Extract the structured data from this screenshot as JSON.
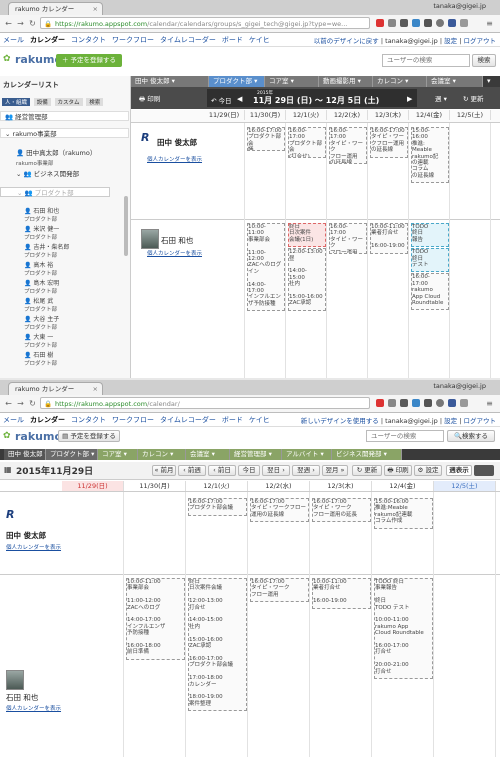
{
  "browser": {
    "tab_title": "rakumo カレンダー",
    "user": "tanaka@gigei.jp",
    "url_old_host": "https://rakumo.appspot.com",
    "url_old_path": "/calendar/calendars/groups/s_gigei_tech@gigei.jp?type=we...",
    "url_new_host": "https://rakumo.appspot.com",
    "url_new_path": "/calendar/"
  },
  "app_nav": {
    "items": [
      "メール",
      "カレンダー",
      "コンタクト",
      "ワークフロー",
      "タイムレコーダー",
      "ボード",
      "ケイヒ"
    ],
    "old_design_link": "以前のデザインに戻す",
    "new_design_link": "新しいデザインを使用する",
    "user": "tanaka@gigei.jp",
    "settings": "設定",
    "logout": "ログアウト",
    "sep": "|"
  },
  "top": {
    "logo": "rakumo",
    "add_button": "予定を登録する",
    "search_placeholder": "ユーザーの検索",
    "search_button": "検索",
    "sidebar_title": "カレンダーリスト",
    "sidebar_tabs": [
      "人・組織",
      "設備",
      "カスタム",
      "検索"
    ],
    "sidebar_tree": [
      "経営管理部",
      "rakumo事業部",
      "田中真太郎（rakumo）",
      "rakumo事業部",
      "ビジネス開発部",
      "プロダクト部"
    ],
    "sidebar_people": [
      "石田 和也",
      "米沢 健一",
      "吉井・柴名郎",
      "高木 裕",
      "島木 宏明",
      "松尾 武",
      "大谷 主子",
      "大東 一",
      "石田 樹"
    ],
    "sidebar_role": "プロダクト部",
    "groups": [
      "田中 俊太郎",
      "プロダクト部",
      "コア室",
      "動画撮影用",
      "カレコン",
      "会議室"
    ],
    "print": "印刷",
    "today": "今日",
    "year": "2015年",
    "range": "11月 29日 (日) 〜 12月 5日 (土)",
    "week": "週",
    "refresh": "更新",
    "days": [
      "11/29(日)",
      "11/30(月)",
      "12/1(火)",
      "12/2(水)",
      "12/3(木)",
      "12/4(金)",
      "12/5(土)"
    ],
    "person1": "田中 俊太郎",
    "person1_link": "個人カレンダーを表示",
    "person2": "石田 和也",
    "person2_link": "個人カレンダーを表示",
    "p1_events": [
      {
        "d": 1,
        "t": "16:00-17:00\nプロダクト部会\n議"
      },
      {
        "d": 2,
        "t": "16:00-\n17:00\nプロダクト部会\n(打合せ)"
      },
      {
        "d": 3,
        "t": "16:00-\n17:00\nタイピ・ワーク\nフロー運用\nの延長線"
      },
      {
        "d": 4,
        "t": "16:00-17:00\nタイピ・ワー\nクフロー運用\nの延長線"
      },
      {
        "d": 5,
        "t": "15:00-\n16:00\n推進:\nMeable\nrakumo記\nの連載\nコラム\nの延長線"
      }
    ],
    "p2_events": [
      {
        "d": 1,
        "t": "10:00-\n11:00\n事業部会\n\n11:00-\n12:00\nZACへのログ\nイン\n\n14:00-\n17:00\nインフルエン\nザ予防接種"
      },
      {
        "d": 2,
        "t": "終日\n日次案件\n会議(1日)",
        "cls": "red"
      },
      {
        "d": 2,
        "t": "12:00-13:00\n昼\n\n14:00-\n15:00\n社内\n\n15:00-16:00\nZAC承認"
      },
      {
        "d": 3,
        "t": "16:00-\n17:00\nタイピ・ワーク\nフロー運用"
      },
      {
        "d": 4,
        "t": "10:00-11:00\n業者打合せ\n\n16:00-19:00"
      },
      {
        "d": 5,
        "t": "TODO\n終日\n報告",
        "cls": "box"
      },
      {
        "d": 5,
        "t": "TODO\n終日\nテスト",
        "cls": "box"
      },
      {
        "d": 5,
        "t": "16:00-\n17:00\nrakumo\nApp Cloud\nRoundtable"
      }
    ]
  },
  "bottom": {
    "logo": "rakumo",
    "add_button": "予定を登録する",
    "search_placeholder": "ユーザーの検索",
    "search_button": "検索する",
    "groups": [
      "田中 俊太郎",
      "プロダクト部",
      "コア室",
      "カレコン",
      "会議室",
      "経営管理部",
      "アルバイト",
      "ビジネス開発部"
    ],
    "date_title": "2015年11月29日",
    "nav": [
      "前月",
      "前週",
      "前日",
      "今日",
      "翌日",
      "翌週",
      "翌月"
    ],
    "refresh": "更新",
    "print": "印刷",
    "settings": "設定",
    "week": "週表示",
    "days": [
      "11/29(日)",
      "11/30(月)",
      "12/1(火)",
      "12/2(水)",
      "12/3(木)",
      "12/4(金)",
      "12/5(土)"
    ],
    "person1": "田中 俊太郎",
    "person1_link": "個人カレンダーを表示",
    "person2": "石田 和也",
    "person2_link": "個人カレンダーを表示",
    "p1_events": [
      {
        "d": 2,
        "t": "16:00-17:00\nプロダクト部会議"
      },
      {
        "d": 3,
        "t": "16:00-17:00\nタイピ・ワークフロー\n運用の延長線"
      },
      {
        "d": 4,
        "t": "16:00-17:00\nタイピ・ワーク\nフロー運用の延長"
      },
      {
        "d": 5,
        "t": "15:00-16:00\n推進:Meable\nrakumo記連載\nコラム作成"
      }
    ],
    "p2_events": [
      {
        "d": 1,
        "t": "10:00-11:00\n事業部会\n\n11:00-12:00\nZACへのログ\n\n14:00-17:00\nインフルエンザ\n予防接種\n\n16:00-18:00\n前日準備"
      },
      {
        "d": 2,
        "t": "終日\n日次案件会議\n\n12:00-13:00\n打合せ\n\n14:00-15:00\n社内\n\n15:00-16:00\nZAC承認\n\n16:00-17:00\nプロダクト部会議\n\n17:00-18:00\nカレンダー\n\n18:00-19:00\n案件整理"
      },
      {
        "d": 3,
        "t": "16:00-17:00\nタイピ・ワーク\nフロー運用"
      },
      {
        "d": 4,
        "t": "10:00-11:00\n業者打合せ\n\n16:00-19:00"
      },
      {
        "d": 5,
        "t": "TODO 終日\n事業報告\n\n終日\nTODO テスト\n\n10:00-11:00\nrakumo App\nCloud Roundtable\n\n16:00-17:00\n打合せ\n\n20:00-21:00\n打合せ"
      }
    ]
  },
  "colors": {
    "accent": "#5a8fcc",
    "green": "#6cb23a",
    "dark": "#3a3a3a"
  }
}
